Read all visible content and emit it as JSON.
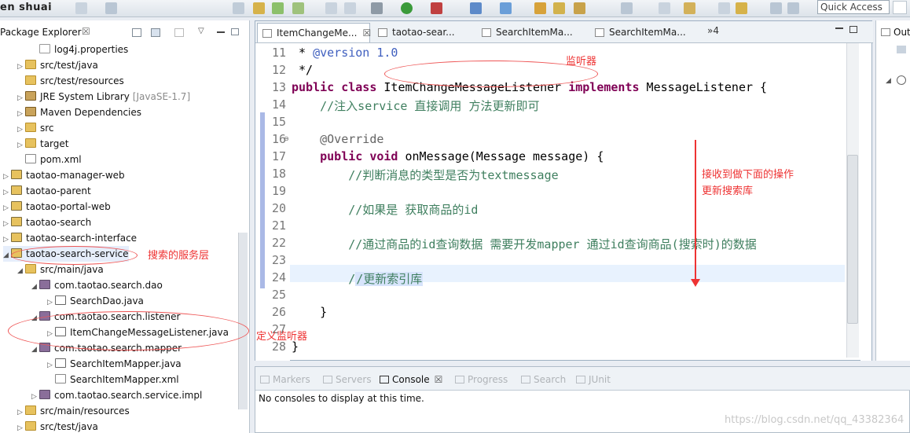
{
  "toolbar": {
    "brand": "en shuai",
    "quick_access": "Quick Access"
  },
  "package_explorer": {
    "title": "Package Explorer",
    "close": "☒",
    "items": [
      {
        "label": "log4j.properties",
        "icon": "file-icon",
        "indent": 2,
        "twisty": ""
      },
      {
        "label": "src/test/java",
        "icon": "folder-icon",
        "indent": 1,
        "twisty": "▷"
      },
      {
        "label": "src/test/resources",
        "icon": "folder-icon",
        "indent": 1,
        "twisty": ""
      },
      {
        "label": "JRE System Library",
        "suffix": "[JavaSE-1.7]",
        "icon": "library-icon",
        "indent": 1,
        "twisty": "▷"
      },
      {
        "label": "Maven Dependencies",
        "icon": "library-icon",
        "indent": 1,
        "twisty": "▷"
      },
      {
        "label": "src",
        "icon": "folder-icon",
        "indent": 1,
        "twisty": "▷"
      },
      {
        "label": "target",
        "icon": "folder-icon",
        "indent": 1,
        "twisty": "▷"
      },
      {
        "label": "pom.xml",
        "icon": "xml-file-icon",
        "indent": 1,
        "twisty": ""
      },
      {
        "label": "taotao-manager-web",
        "icon": "project-icon",
        "indent": 0,
        "twisty": "▷"
      },
      {
        "label": "taotao-parent",
        "icon": "project-icon",
        "indent": 0,
        "twisty": "▷"
      },
      {
        "label": "taotao-portal-web",
        "icon": "project-icon",
        "indent": 0,
        "twisty": "▷"
      },
      {
        "label": "taotao-search",
        "icon": "project-icon",
        "indent": 0,
        "twisty": "▷"
      },
      {
        "label": "taotao-search-interface",
        "icon": "project-icon",
        "indent": 0,
        "twisty": "▷"
      },
      {
        "label": "taotao-search-service",
        "icon": "project-icon",
        "indent": 0,
        "twisty": "◢"
      },
      {
        "label": "src/main/java",
        "icon": "folder-icon",
        "indent": 1,
        "twisty": "◢"
      },
      {
        "label": "com.taotao.search.dao",
        "icon": "package-icon",
        "indent": 2,
        "twisty": "◢"
      },
      {
        "label": "SearchDao.java",
        "icon": "java-file-icon",
        "indent": 3,
        "twisty": "▷"
      },
      {
        "label": "com.taotao.search.listener",
        "icon": "package-icon",
        "indent": 2,
        "twisty": "◢"
      },
      {
        "label": "ItemChangeMessageListener.java",
        "icon": "java-file-icon",
        "indent": 3,
        "twisty": "▷"
      },
      {
        "label": "com.taotao.search.mapper",
        "icon": "package-icon",
        "indent": 2,
        "twisty": "◢"
      },
      {
        "label": "SearchItemMapper.java",
        "icon": "java-file-icon",
        "indent": 3,
        "twisty": "▷"
      },
      {
        "label": "SearchItemMapper.xml",
        "icon": "xml-file-icon",
        "indent": 3,
        "twisty": ""
      },
      {
        "label": "com.taotao.search.service.impl",
        "icon": "package-icon",
        "indent": 2,
        "twisty": "▷"
      },
      {
        "label": "src/main/resources",
        "icon": "folder-icon",
        "indent": 1,
        "twisty": "▷"
      },
      {
        "label": "src/test/java",
        "icon": "folder-icon",
        "indent": 1,
        "twisty": "▷"
      }
    ]
  },
  "editor": {
    "tabs": [
      {
        "label": "ItemChangeMe...",
        "close": "☒",
        "active": true
      },
      {
        "label": "taotao-sear..."
      },
      {
        "label": "SearchItemMa..."
      },
      {
        "label": "SearchItemMa..."
      }
    ],
    "overflow": "»4",
    "lines": [
      {
        "n": "11",
        "html": " * <span class=\"doc\">@version 1.0</span>"
      },
      {
        "n": "12",
        "html": " */"
      },
      {
        "n": "13",
        "html": "<span class=\"kw\">public class</span> ItemChangeMessageListener <span class=\"kw\">implements</span> MessageListener {"
      },
      {
        "n": "14",
        "html": "    <span class=\"cm\">//注入service 直接调用 方法更新即可</span>"
      },
      {
        "n": "15",
        "html": ""
      },
      {
        "n": "16",
        "html": "    <span class=\"ann\">@Override</span>",
        "fold": "⊖"
      },
      {
        "n": "17",
        "html": "    <span class=\"kw\">public void</span> onMessage(Message message) {"
      },
      {
        "n": "18",
        "html": "        <span class=\"cm\">//判断消息的类型是否为textmessage</span>"
      },
      {
        "n": "19",
        "html": ""
      },
      {
        "n": "20",
        "html": "        <span class=\"cm\">//如果是 获取商品的id</span>"
      },
      {
        "n": "21",
        "html": ""
      },
      {
        "n": "22",
        "html": "        <span class=\"cm\">//通过商品的id查询数据 需要开发mapper 通过id查询商品(搜索时)的数据</span>"
      },
      {
        "n": "23",
        "html": ""
      },
      {
        "n": "24",
        "html": "        <span class=\"cm\">/</span><span class=\"hlw\">/更新索引库</span>"
      },
      {
        "n": "25",
        "html": ""
      },
      {
        "n": "26",
        "html": "    }"
      },
      {
        "n": "27",
        "html": ""
      },
      {
        "n": "28",
        "html": "}"
      }
    ]
  },
  "annotations": {
    "listener": "监听器",
    "after_receive": "接收到做下面的操作",
    "update_index": "更新搜索库",
    "search_service": "搜索的服务层",
    "define_listener": "定义监听器"
  },
  "console": {
    "tabs": [
      "Markers",
      "Servers",
      "Console",
      "Progress",
      "Search",
      "JUnit"
    ],
    "active_tab": "Console",
    "message": "No consoles to display at this time."
  },
  "outline": {
    "title": "Out"
  },
  "watermark": "https://blog.csdn.net/qq_43382364"
}
